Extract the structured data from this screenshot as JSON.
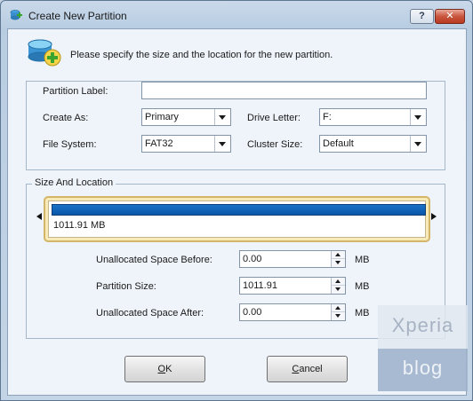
{
  "window": {
    "title": "Create New Partition",
    "help_label": "?",
    "close_label": "✕"
  },
  "header": {
    "instruction": "Please specify the size and the location for the new partition."
  },
  "partition_settings": {
    "label_caption": "Partition Label:",
    "label_value": "",
    "create_as_caption": "Create As:",
    "create_as_value": "Primary",
    "drive_letter_caption": "Drive Letter:",
    "drive_letter_value": "F:",
    "file_system_caption": "File System:",
    "file_system_value": "FAT32",
    "cluster_size_caption": "Cluster Size:",
    "cluster_size_value": "Default"
  },
  "size_location": {
    "group_title": "Size And Location",
    "disk_map_size": "1011.91 MB",
    "disk_map_fill_fraction": 1.0,
    "unalloc_before_caption": "Unallocated Space Before:",
    "unalloc_before_value": "0.00",
    "partition_size_caption": "Partition Size:",
    "partition_size_value": "1011.91",
    "unalloc_after_caption": "Unallocated Space After:",
    "unalloc_after_value": "0.00",
    "unit": "MB"
  },
  "buttons": {
    "ok_label": "OK",
    "ok_mnemonic": "O",
    "ok_rest": "K",
    "cancel_label": "Cancel",
    "cancel_mnemonic": "C",
    "cancel_rest": "ancel"
  },
  "watermark": {
    "top": "Xperia",
    "bottom": "blog"
  },
  "colors": {
    "bar_fill": "#0756a8",
    "disk_frame": "#d4b66a",
    "window_bg": "#c6d5e6"
  }
}
